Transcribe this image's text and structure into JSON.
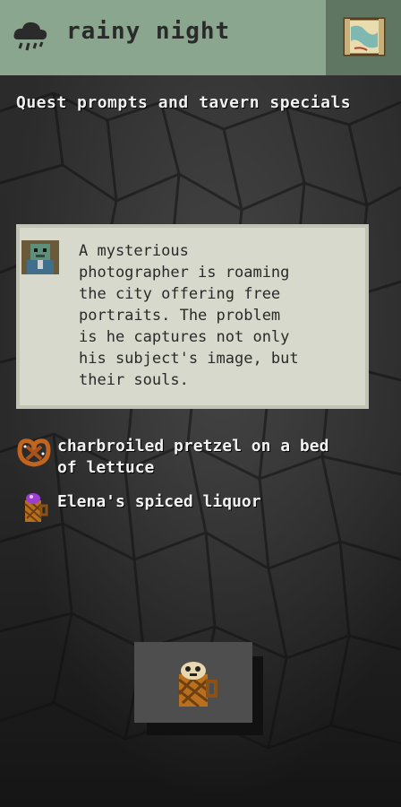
{
  "header": {
    "weather_icon": "rain-cloud-icon",
    "weather": "rainy night",
    "map_icon": "map-icon"
  },
  "subtitle": "Quest prompts and tavern specials",
  "quest": {
    "portrait_icon": "zombie-portrait-icon",
    "text": "A mysterious\nphotographer is roaming\nthe city offering free\nportraits. The problem\nis he captures not only\nhis subject's image, but\ntheir souls."
  },
  "specials": [
    {
      "icon": "pretzel-icon",
      "label": "charbroiled pretzel on a bed of lettuce"
    },
    {
      "icon": "liquor-mug-icon",
      "label": "Elena's spiced liquor"
    }
  ],
  "selected_item": {
    "icon": "liquor-mug-icon"
  },
  "colors": {
    "header": "#8aa68f",
    "map_button": "#5f7663",
    "card": "#d7d9cc",
    "slot": "#4e4e4e"
  }
}
